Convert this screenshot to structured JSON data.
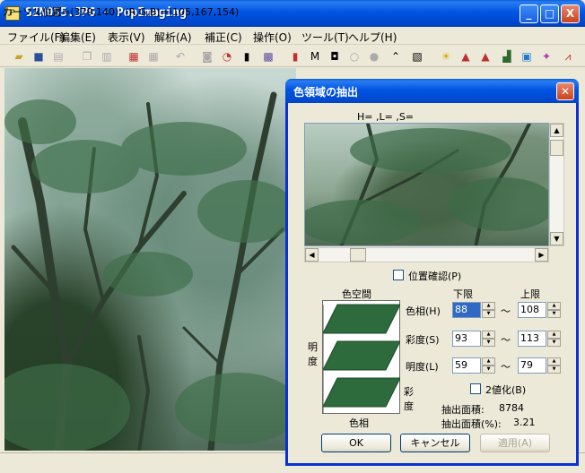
{
  "window": {
    "title": "SZN055.JPG - PopImaging",
    "buttons": {
      "minimize": "_",
      "maximize": "□",
      "close": "X"
    }
  },
  "menu": [
    "ファイル(F)",
    "編集(E)",
    "表示(V)",
    "解析(A)",
    "補正(C)",
    "操作(O)",
    "ツール(T)",
    "ヘルプ(H)"
  ],
  "toolbar": {
    "icons": [
      "open-folder-icon",
      "save-icon",
      "print-icon",
      "copy-icon",
      "paste-icon",
      "grid-icon",
      "table-icon",
      "undo-icon",
      "camera-icon",
      "clock-icon",
      "ruler-icon",
      "pattern-icon",
      "color-bars-icon",
      "histogram-icon",
      "shape-icon",
      "circle-icon",
      "gear-icon",
      "curve-icon",
      "hatch-icon",
      "sun-icon",
      "triangle-icon",
      "triangle-red-icon",
      "stairs-icon",
      "crop-icon",
      "color-select-icon",
      "levels-icon"
    ]
  },
  "status": {
    "text": "カーソル位置=(379,140), (R,G,B)=(105,167,154)"
  },
  "dialog": {
    "title": "色領域の抽出",
    "hls_readout": "H= ,L= ,S=",
    "position_check_label": "位置確認(P)",
    "colorspace": {
      "title": "色空間",
      "axis_left": "明度",
      "axis_right": "彩度",
      "axis_bottom": "色相",
      "color": "#2d6b3c"
    },
    "range": {
      "lower_header": "下限",
      "upper_header": "上限",
      "tilde": "～",
      "rows": [
        {
          "label": "色相(H)",
          "lower": "88",
          "upper": "108"
        },
        {
          "label": "彩度(S)",
          "lower": "93",
          "upper": "113"
        },
        {
          "label": "明度(L)",
          "lower": "59",
          "upper": "79"
        }
      ]
    },
    "binarize_label": "2値化(B)",
    "area_label": "抽出面積:",
    "area_value": "8784",
    "area_pct_label": "抽出面積(%):",
    "area_pct_value": "3.21",
    "buttons": {
      "ok": "OK",
      "cancel": "キャンセル",
      "apply": "適用(A)"
    }
  }
}
